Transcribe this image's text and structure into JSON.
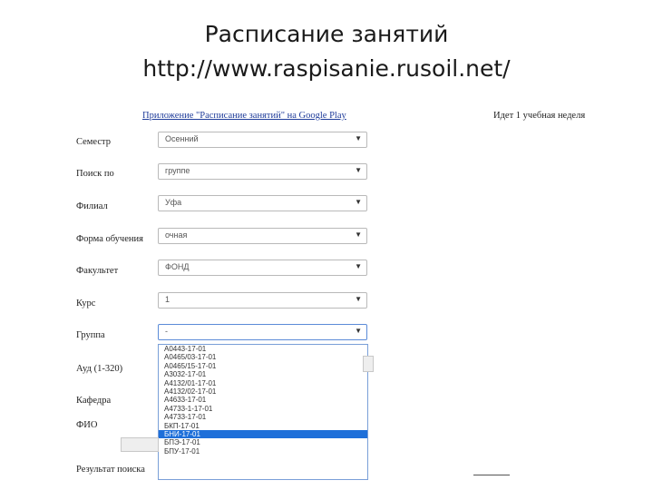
{
  "slide": {
    "title_line1": "Расписание занятий",
    "title_line2": "http://www.raspisanie.rusoil.net/"
  },
  "header": {
    "app_link": "Приложение \"Расписание занятий\" на Google Play",
    "week_text": "Идет 1 учебная неделя"
  },
  "form": {
    "semester": {
      "label": "Семестр",
      "value": "Осенний"
    },
    "search_by": {
      "label": "Поиск по",
      "value": "группе"
    },
    "branch": {
      "label": "Филиал",
      "value": "Уфа"
    },
    "study_form": {
      "label": "Форма обучения",
      "value": "очная"
    },
    "faculty": {
      "label": "Факультет",
      "value": "ФОНД"
    },
    "course": {
      "label": "Курс",
      "value": "1"
    },
    "group": {
      "label": "Группа",
      "value": "-"
    },
    "auditorium": {
      "label": "Ауд (1-320)"
    },
    "department": {
      "label": "Кафедра"
    },
    "fio": {
      "label": "ФИО"
    },
    "result": {
      "label": "Результат поиска"
    }
  },
  "group_options": [
    "А0443-17-01",
    "А0465/03-17-01",
    "А0465/15-17-01",
    "А3032-17-01",
    "А4132/01-17-01",
    "А4132/02-17-01",
    "А4633-17-01",
    "А4733-1-17-01",
    "А4733-17-01",
    "БКП-17-01",
    "БНИ-17-01",
    "БПЭ-17-01",
    "БПУ-17-01"
  ],
  "selected_group_option": "БНИ-17-01",
  "icons": {
    "dropdown": "chevron-down-icon",
    "arrow_glyph": "▼"
  },
  "colors": {
    "link": "#1f3c9a",
    "highlight": "#1e6fd9",
    "focus_border": "#5b8bd8"
  }
}
